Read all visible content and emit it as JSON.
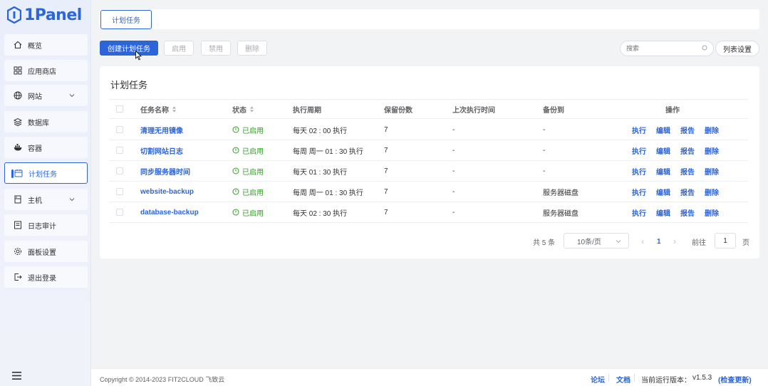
{
  "app": {
    "logo_text": "1Panel"
  },
  "sidebar": {
    "items": [
      {
        "label": "概览",
        "icon": "home-icon"
      },
      {
        "label": "应用商店",
        "icon": "apps-icon"
      },
      {
        "label": "网站",
        "icon": "globe-icon",
        "expandable": true
      },
      {
        "label": "数据库",
        "icon": "database-icon"
      },
      {
        "label": "容器",
        "icon": "container-icon"
      },
      {
        "label": "计划任务",
        "icon": "schedule-icon",
        "active": true
      },
      {
        "label": "主机",
        "icon": "host-icon",
        "expandable": true
      },
      {
        "label": "日志审计",
        "icon": "log-icon"
      },
      {
        "label": "面板设置",
        "icon": "gear-icon"
      },
      {
        "label": "退出登录",
        "icon": "logout-icon"
      }
    ]
  },
  "tabs": {
    "active_label": "计划任务"
  },
  "toolbar": {
    "create_label": "创建计划任务",
    "enable_label": "启用",
    "disable_label": "禁用",
    "delete_label": "删除",
    "search_placeholder": "搜索",
    "columns_label": "列表设置"
  },
  "card": {
    "title": "计划任务"
  },
  "table": {
    "headers": {
      "name": "任务名称",
      "status": "状态",
      "cycle": "执行周期",
      "retain": "保留份数",
      "last_run": "上次执行时间",
      "backup_to": "备份到",
      "actions": "操作"
    },
    "rows": [
      {
        "name": "清理无用镜像",
        "status": "已启用",
        "cycle": "每天 02 : 00 执行",
        "retain": "7",
        "last_run": "-",
        "backup_to": "-"
      },
      {
        "name": "切割网站日志",
        "status": "已启用",
        "cycle": "每周 周一 01 : 30 执行",
        "retain": "7",
        "last_run": "-",
        "backup_to": "-"
      },
      {
        "name": "同步服务器时间",
        "status": "已启用",
        "cycle": "每天 01 : 30 执行",
        "retain": "7",
        "last_run": "-",
        "backup_to": "-"
      },
      {
        "name": "website-backup",
        "status": "已启用",
        "cycle": "每周 周一 01 : 30 执行",
        "retain": "7",
        "last_run": "-",
        "backup_to": "服务器磁盘"
      },
      {
        "name": "database-backup",
        "status": "已启用",
        "cycle": "每天 02 : 30 执行",
        "retain": "7",
        "last_run": "-",
        "backup_to": "服务器磁盘"
      }
    ],
    "row_actions": [
      "执行",
      "编辑",
      "报告",
      "删除"
    ]
  },
  "pagination": {
    "total_text": "共 5 条",
    "page_size": "10条/页",
    "current_page": "1",
    "goto_label": "前往",
    "goto_value": "1",
    "page_suffix": "页",
    "prev_glyph": "‹",
    "next_glyph": "›"
  },
  "footer": {
    "copyright": "Copyright © 2014-2023 FIT2CLOUD 飞致云",
    "forum": "论坛",
    "docs": "文档",
    "version_label": "当前运行版本：",
    "version": "v1.5.3",
    "check_update": "(检查更新)"
  },
  "colors": {
    "primary": "#2b65d9",
    "success": "#2ea121",
    "sidebar_bg": "#e9eefb",
    "page_bg": "#f2f3f5"
  }
}
